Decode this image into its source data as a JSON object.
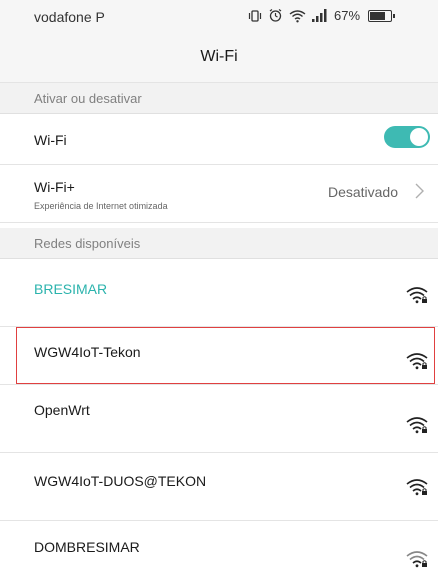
{
  "status_bar": {
    "carrier": "vodafone P",
    "battery_percent": "67%",
    "battery_level": 0.67,
    "icons": [
      "vibrate-icon",
      "alarm-icon",
      "wifi-icon",
      "signal-icon",
      "battery-icon"
    ]
  },
  "header": {
    "title": "Wi-Fi"
  },
  "sections": {
    "toggle_section": "Ativar ou desativar",
    "networks_section": "Redes disponíveis"
  },
  "wifi_toggle": {
    "label": "Wi-Fi",
    "state": "on"
  },
  "wifi_plus": {
    "label": "Wi-Fi+",
    "subtitle": "Experiência de Internet otimizada",
    "value": "Desativado"
  },
  "networks": [
    {
      "name": "BRESIMAR",
      "connected": true,
      "secured": true
    },
    {
      "name": "WGW4IoT-Tekon",
      "connected": false,
      "secured": true,
      "selected": true
    },
    {
      "name": "OpenWrt",
      "connected": false,
      "secured": true
    },
    {
      "name": "WGW4IoT-DUOS@TEKON",
      "connected": false,
      "secured": true
    },
    {
      "name": "DOMBRESIMAR",
      "connected": false,
      "secured": true
    }
  ],
  "colors": {
    "accent": "#2bb3ad",
    "toggle_on": "#3ebab3",
    "selection_outline": "#e04040"
  }
}
